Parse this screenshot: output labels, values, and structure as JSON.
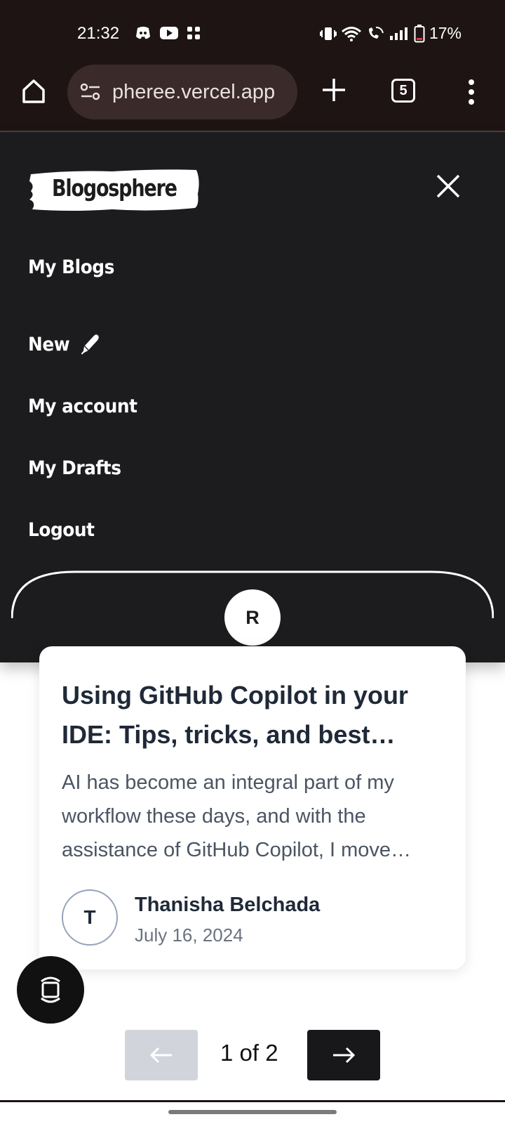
{
  "status_bar": {
    "time": "21:32",
    "battery": "17%",
    "icons": [
      "discord-icon",
      "youtube-icon",
      "app-grid-icon",
      "vibrate-icon",
      "wifi-icon",
      "wifi-calling-icon",
      "signal-icon",
      "battery-icon"
    ]
  },
  "browser": {
    "url": "pheree.vercel.app",
    "tab_count": "5"
  },
  "nav": {
    "logo_text": "Blogosphere",
    "items": [
      {
        "label": "My Blogs"
      },
      {
        "label": "New"
      },
      {
        "label": "My account"
      },
      {
        "label": "My Drafts"
      },
      {
        "label": "Logout"
      }
    ],
    "user_initial": "R"
  },
  "post": {
    "title": "Using GitHub Copilot in your IDE: Tips, tricks, and best…",
    "excerpt": "AI has become an integral part of my workflow these days, and with the assistance of GitHub Copilot, I move…",
    "author_initial": "T",
    "author_name": "Thanisha Belchada",
    "date": "July 16, 2024"
  },
  "pagination": {
    "label": "1 of 2"
  }
}
